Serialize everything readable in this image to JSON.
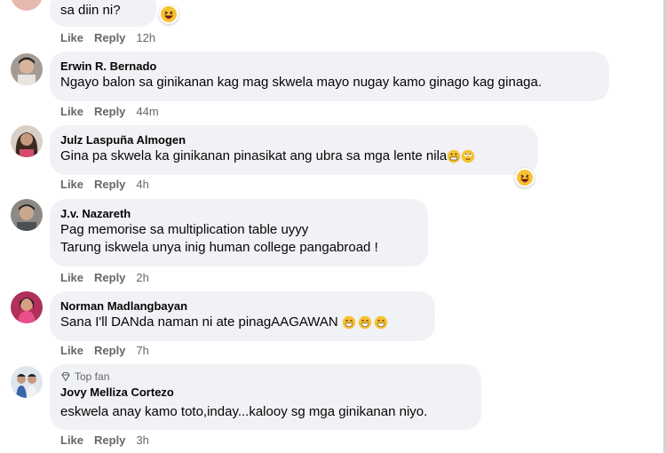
{
  "comments": [
    {
      "author": "",
      "text": "sa diin ni?",
      "like": "Like",
      "reply": "Reply",
      "time": "12h",
      "reaction": "haha"
    },
    {
      "author": "Erwin R. Bernado",
      "text": "Ngayo balon sa ginikanan kag mag skwela mayo nugay kamo ginago kag ginaga.",
      "like": "Like",
      "reply": "Reply",
      "time": "44m"
    },
    {
      "author": "Julz Laspuña Almogen",
      "text": "Gina pa skwela ka ginikanan pinasikat ang ubra sa mga lente nila",
      "like": "Like",
      "reply": "Reply",
      "time": "4h",
      "reaction": "haha"
    },
    {
      "author": "J.v. Nazareth",
      "text_line1": "Pag memorise sa multiplication table uyyy",
      "text_line2": "Tarung iskwela unya inig human college pangabroad !",
      "like": "Like",
      "reply": "Reply",
      "time": "2h"
    },
    {
      "author": "Norman Madlangbayan",
      "text": "Sana I'll DANda naman ni ate pinagAAGAWAN",
      "like": "Like",
      "reply": "Reply",
      "time": "7h"
    },
    {
      "badge": "Top fan",
      "author": "Jovy Melliza Cortezo",
      "text": "eskwela anay kamo toto,inday...kalooy sg mga ginikanan niyo.",
      "like": "Like",
      "reply": "Reply",
      "time": "3h"
    }
  ]
}
